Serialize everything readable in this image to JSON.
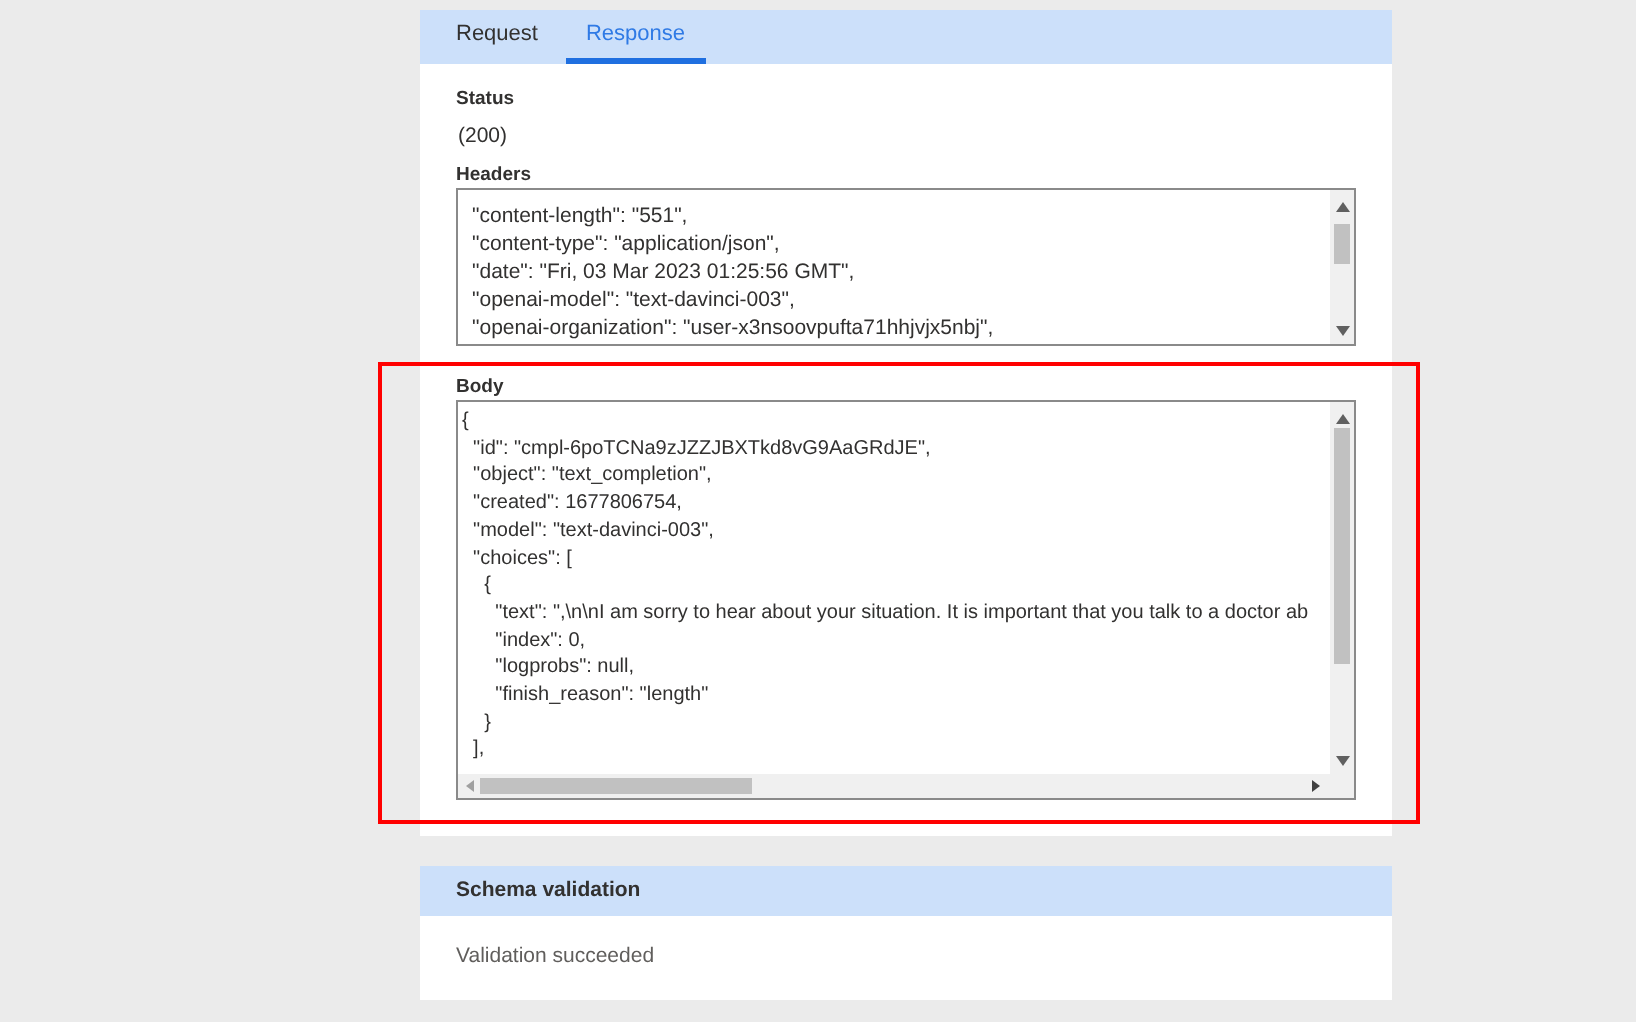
{
  "tabs": [
    {
      "label": "Request",
      "selected": false
    },
    {
      "label": "Response",
      "selected": true
    }
  ],
  "status": {
    "label": "Status",
    "value": "(200)"
  },
  "headers": {
    "label": "Headers",
    "lines": [
      "\"content-length\": \"551\",",
      "\"content-type\": \"application/json\",",
      "\"date\": \"Fri, 03 Mar 2023 01:25:56 GMT\",",
      "\"openai-model\": \"text-davinci-003\",",
      "\"openai-organization\": \"user-x3nsoovpufta71hhjvjx5nbj\","
    ]
  },
  "body": {
    "label": "Body",
    "lines": [
      "{",
      "  \"id\": \"cmpl-6poTCNa9zJZZJBXTkd8vG9AaGRdJE\",",
      "  \"object\": \"text_completion\",",
      "  \"created\": 1677806754,",
      "  \"model\": \"text-davinci-003\",",
      "  \"choices\": [",
      "    {",
      "      \"text\": \",\\n\\nI am sorry to hear about your situation. It is important that you talk to a doctor ab",
      "      \"index\": 0,",
      "      \"logprobs\": null,",
      "      \"finish_reason\": \"length\"",
      "    }",
      "  ],"
    ]
  },
  "schema_validation": {
    "title": "Schema validation",
    "message": "Validation succeeded"
  }
}
